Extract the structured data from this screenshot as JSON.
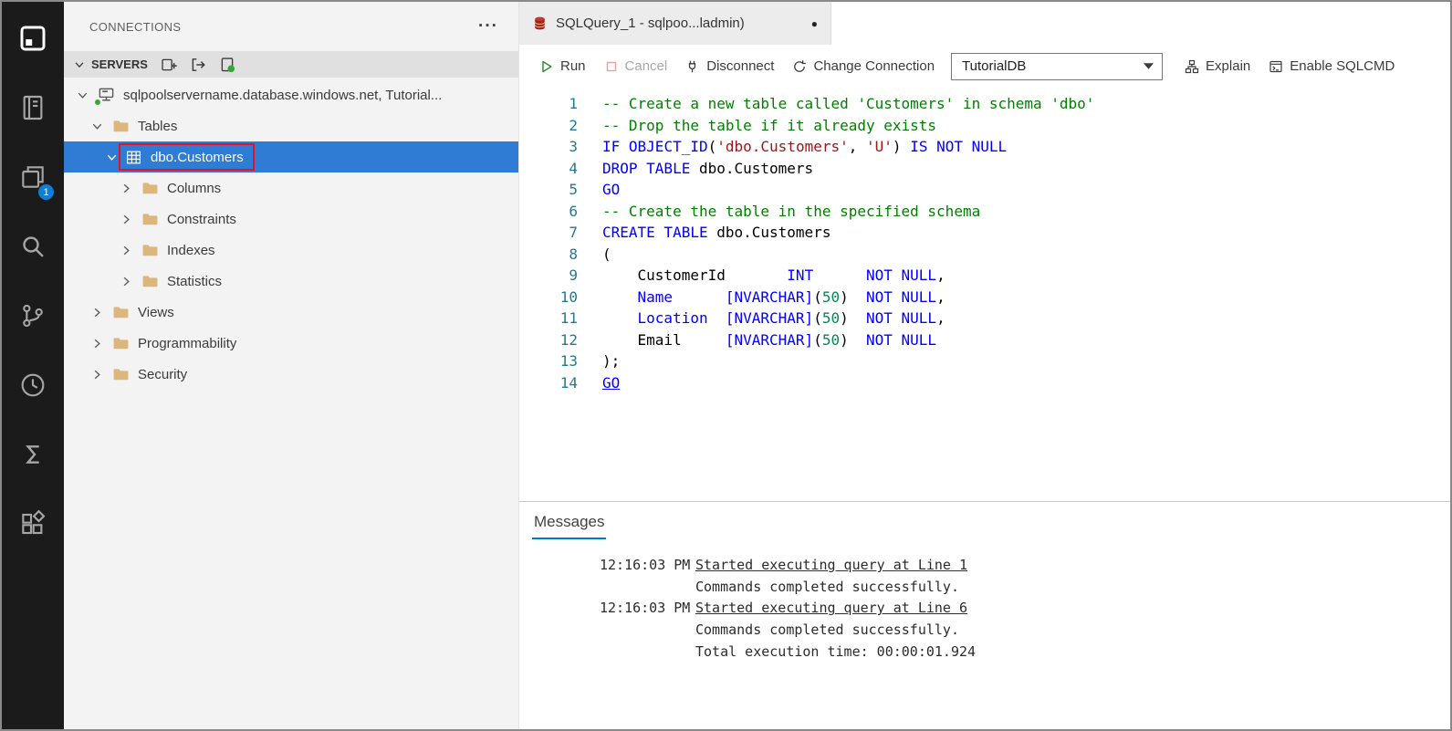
{
  "colors": {
    "accent": "#0078d4",
    "selection_blue": "#2e7cd4",
    "annotation_red": "#e81123",
    "run_green": "#388a34",
    "status_green": "#37a637",
    "line_number_blue": "#237893",
    "activity_badge": "#0f7fd4",
    "syntax_comment": "#008000",
    "syntax_keyword": "#0000ff",
    "syntax_string": "#a31515",
    "syntax_number": "#098658"
  },
  "activity_bar": {
    "badge_count": "1",
    "icons": [
      "connections",
      "notebook",
      "explorer",
      "search",
      "source-control",
      "task-history",
      "sigma",
      "extensions"
    ]
  },
  "sidebar": {
    "header": {
      "title": "CONNECTIONS",
      "menu_icon": "···"
    },
    "servers_section": {
      "label": "SERVERS",
      "action_icons": [
        "new-connection",
        "connect",
        "active-connections"
      ]
    },
    "tree": [
      {
        "label": "sqlpoolservername.database.windows.net, Tutorial...",
        "level": 0,
        "icon": "server",
        "expanded": true,
        "status_dot": "#37a637"
      },
      {
        "label": "Tables",
        "level": 1,
        "icon": "folder",
        "expanded": true
      },
      {
        "label": "dbo.Customers",
        "level": 2,
        "icon": "table",
        "expanded": true,
        "selected": true,
        "annotated": true
      },
      {
        "label": "Columns",
        "level": 3,
        "icon": "folder",
        "expanded": false
      },
      {
        "label": "Constraints",
        "level": 3,
        "icon": "folder",
        "expanded": false
      },
      {
        "label": "Indexes",
        "level": 3,
        "icon": "folder",
        "expanded": false
      },
      {
        "label": "Statistics",
        "level": 3,
        "icon": "folder",
        "expanded": false
      },
      {
        "label": "Views",
        "level": 1,
        "icon": "folder",
        "expanded": false
      },
      {
        "label": "Programmability",
        "level": 1,
        "icon": "folder",
        "expanded": false
      },
      {
        "label": "Security",
        "level": 1,
        "icon": "folder",
        "expanded": false
      }
    ]
  },
  "editor_tab": {
    "title": "SQLQuery_1 - sqlpoo...ladmin)",
    "dirty_indicator": "●"
  },
  "toolbar": {
    "run": "Run",
    "cancel": "Cancel",
    "disconnect": "Disconnect",
    "change_connection": "Change Connection",
    "database_selector": "TutorialDB",
    "explain": "Explain",
    "enable_sqlcmd": "Enable SQLCMD"
  },
  "editor": {
    "lines": [
      {
        "n": 1,
        "tokens": [
          [
            "-- Create a new table called 'Customers' in schema 'dbo'",
            "c"
          ]
        ]
      },
      {
        "n": 2,
        "tokens": [
          [
            "-- Drop the table if it already exists",
            "c"
          ]
        ]
      },
      {
        "n": 3,
        "tokens": [
          [
            "IF",
            "k"
          ],
          [
            " ",
            "p"
          ],
          [
            "OBJECT_ID",
            "k"
          ],
          [
            "(",
            "p"
          ],
          [
            "'dbo.Customers'",
            "s"
          ],
          [
            ", ",
            "p"
          ],
          [
            "'U'",
            "s"
          ],
          [
            ") ",
            "p"
          ],
          [
            "IS NOT NULL",
            "k"
          ]
        ]
      },
      {
        "n": 4,
        "tokens": [
          [
            "DROP TABLE",
            "k"
          ],
          [
            " dbo.Customers",
            "p"
          ]
        ]
      },
      {
        "n": 5,
        "tokens": [
          [
            "GO",
            "k"
          ]
        ]
      },
      {
        "n": 6,
        "tokens": [
          [
            "-- Create the table in the specified schema",
            "c"
          ]
        ]
      },
      {
        "n": 7,
        "tokens": [
          [
            "CREATE TABLE",
            "k"
          ],
          [
            " dbo.Customers",
            "p"
          ]
        ]
      },
      {
        "n": 8,
        "tokens": [
          [
            "(",
            "p"
          ]
        ]
      },
      {
        "n": 9,
        "tokens": [
          [
            "    CustomerId       ",
            "p"
          ],
          [
            "INT",
            "k"
          ],
          [
            "      ",
            "p"
          ],
          [
            "NOT NULL",
            "k"
          ],
          [
            ",",
            "p"
          ]
        ]
      },
      {
        "n": 10,
        "tokens": [
          [
            "    ",
            "p"
          ],
          [
            "Name",
            "k"
          ],
          [
            "      ",
            "p"
          ],
          [
            "[NVARCHAR]",
            "k"
          ],
          [
            "(",
            "p"
          ],
          [
            "50",
            "n"
          ],
          [
            ")",
            "p"
          ],
          [
            "  ",
            "p"
          ],
          [
            "NOT NULL",
            "k"
          ],
          [
            ",",
            "p"
          ]
        ]
      },
      {
        "n": 11,
        "tokens": [
          [
            "    ",
            "p"
          ],
          [
            "Location",
            "k"
          ],
          [
            "  ",
            "p"
          ],
          [
            "[NVARCHAR]",
            "k"
          ],
          [
            "(",
            "p"
          ],
          [
            "50",
            "n"
          ],
          [
            ")",
            "p"
          ],
          [
            "  ",
            "p"
          ],
          [
            "NOT NULL",
            "k"
          ],
          [
            ",",
            "p"
          ]
        ]
      },
      {
        "n": 12,
        "tokens": [
          [
            "    Email     ",
            "p"
          ],
          [
            "[NVARCHAR]",
            "k"
          ],
          [
            "(",
            "p"
          ],
          [
            "50",
            "n"
          ],
          [
            ")",
            "p"
          ],
          [
            "  ",
            "p"
          ],
          [
            "NOT NULL",
            "k"
          ]
        ]
      },
      {
        "n": 13,
        "tokens": [
          [
            ");",
            "p"
          ]
        ]
      },
      {
        "n": 14,
        "tokens": [
          [
            "GO",
            "k u"
          ]
        ]
      }
    ]
  },
  "messages_panel": {
    "tab": "Messages",
    "rows": [
      {
        "time": "12:16:03 PM",
        "text": "Started executing query at Line 1",
        "link": true
      },
      {
        "time": "",
        "text": "Commands completed successfully.",
        "link": false
      },
      {
        "time": "12:16:03 PM",
        "text": "Started executing query at Line 6",
        "link": true
      },
      {
        "time": "",
        "text": "Commands completed successfully.",
        "link": false
      },
      {
        "time": "",
        "text": "Total execution time: 00:00:01.924",
        "link": false
      }
    ]
  }
}
